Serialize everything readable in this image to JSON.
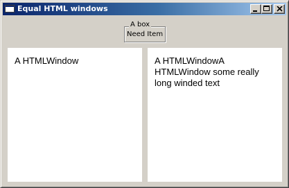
{
  "window": {
    "title": "Equal HTML windows",
    "icons": {
      "app": "window-icon",
      "minimize": "minimize-icon",
      "maximize": "maximize-icon",
      "close": "close-icon"
    }
  },
  "groupbox": {
    "legend": "A box",
    "item": "Need Item"
  },
  "panes": {
    "left": {
      "text": "A HTMLWindow"
    },
    "right": {
      "text": "A HTMLWindowA HTMLWindow some really long winded text"
    }
  },
  "colors": {
    "titlebar_start": "#0a246a",
    "titlebar_end": "#a6caf0",
    "face": "#d4d0c8",
    "pane_bg": "#ffffff"
  }
}
